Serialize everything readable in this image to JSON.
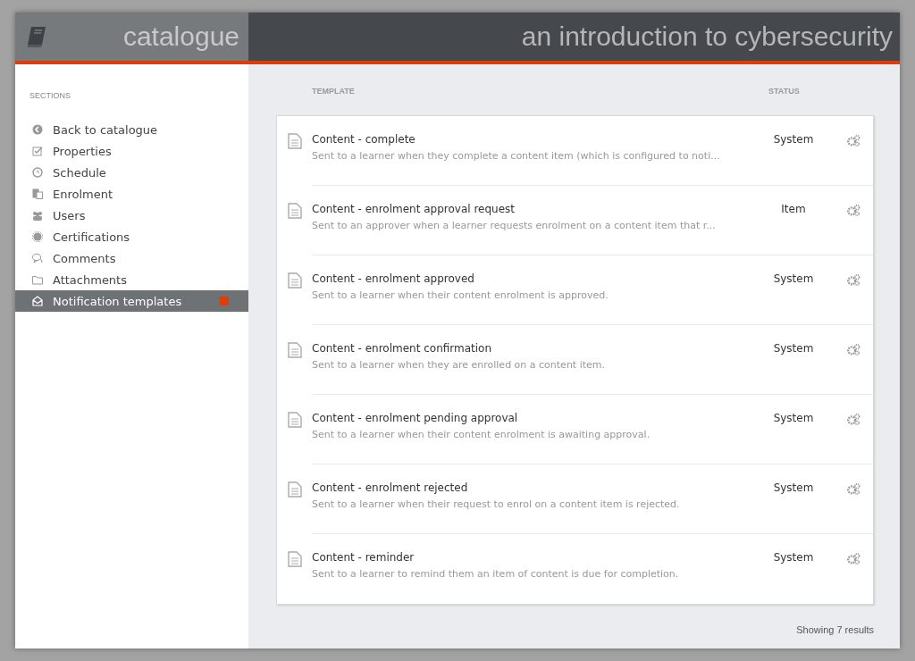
{
  "header": {
    "brand": "catalogue",
    "title": "an introduction to cybersecurity"
  },
  "sidebar": {
    "heading": "SECTIONS",
    "items": [
      {
        "label": "Back to catalogue",
        "selected": false
      },
      {
        "label": "Properties",
        "selected": false
      },
      {
        "label": "Schedule",
        "selected": false
      },
      {
        "label": "Enrolment",
        "selected": false
      },
      {
        "label": "Users",
        "selected": false
      },
      {
        "label": "Certifications",
        "selected": false
      },
      {
        "label": "Comments",
        "selected": false
      },
      {
        "label": "Attachments",
        "selected": false
      },
      {
        "label": "Notification templates",
        "selected": true
      }
    ]
  },
  "table": {
    "columns": [
      "TEMPLATE",
      "STATUS"
    ],
    "rows": [
      {
        "name": "Content - complete",
        "description": "Sent to a learner when they complete a content item (which is configured to noti...",
        "status": "System"
      },
      {
        "name": "Content - enrolment approval request",
        "description": "Sent to an approver when a learner requests enrolment on a content item that r...",
        "status": "Item"
      },
      {
        "name": "Content - enrolment approved",
        "description": "Sent to a learner when their content enrolment is approved.",
        "status": "System"
      },
      {
        "name": "Content - enrolment confirmation",
        "description": "Sent to a learner when they are enrolled on a content item.",
        "status": "System"
      },
      {
        "name": "Content - enrolment pending approval",
        "description": "Sent to a learner when their content enrolment is awaiting approval.",
        "status": "System"
      },
      {
        "name": "Content - enrolment rejected",
        "description": "Sent to a learner when their request to enrol on a content item is rejected.",
        "status": "System"
      },
      {
        "name": "Content - reminder",
        "description": "Sent to a learner to remind them an item of content is due for completion.",
        "status": "System"
      }
    ]
  },
  "footer": "Showing 7 results"
}
